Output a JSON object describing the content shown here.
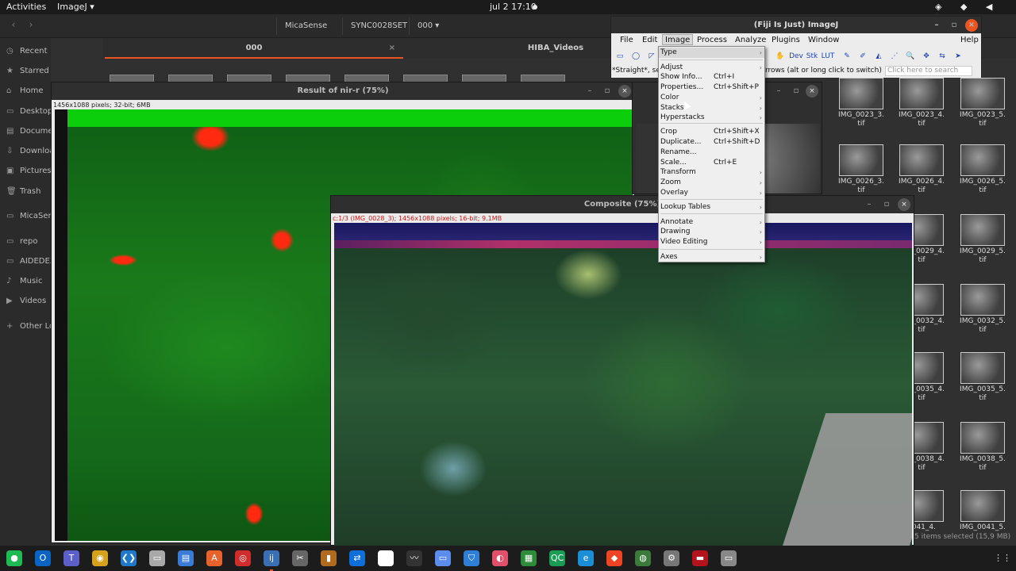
{
  "topbar": {
    "activities": "Activities",
    "app_menu": "ImageJ ▾",
    "clock": "jul 2  17:10",
    "tray": "◈ ◆ ◀ ▮▾"
  },
  "files": {
    "back": "‹",
    "forward": "›",
    "breadcrumbs": [
      "MicaSense",
      "SYNC0028SET",
      "000 ▾"
    ],
    "tabs": [
      "000",
      "HIBA_Videos"
    ],
    "tab_close": "×",
    "sidebar": [
      {
        "icon": "◷",
        "label": "Recent"
      },
      {
        "icon": "★",
        "label": "Starred"
      },
      {
        "icon": "⌂",
        "label": "Home"
      },
      {
        "icon": "▭",
        "label": "Desktop"
      },
      {
        "icon": "▤",
        "label": "Documen"
      },
      {
        "icon": "⇩",
        "label": "Downloa"
      },
      {
        "icon": "▣",
        "label": "Pictures"
      },
      {
        "icon": "🗑",
        "label": "Trash"
      },
      {
        "icon": "▭",
        "label": "MicaSen"
      },
      {
        "icon": "▭",
        "label": "repo"
      },
      {
        "icon": "▭",
        "label": "AIDEDEX"
      },
      {
        "icon": "♪",
        "label": "Music"
      },
      {
        "icon": "▶",
        "label": "Videos"
      },
      {
        "icon": "+",
        "label": "Other Lo"
      }
    ],
    "tiles": [
      "IMG_0023_3.\ntif",
      "IMG_0023_4.\ntif",
      "IMG_0023_5.\ntif",
      "IMG_0026_3.\ntif",
      "IMG_0026_4.\ntif",
      "IMG_0026_5.\ntif",
      "IMG_0029_4.\ntif",
      "IMG_0029_5.\ntif",
      "IMG_0032_4.\ntif",
      "IMG_0032_5.\ntif",
      "IMG_0035_4.\ntif",
      "IMG_0035_5.\ntif",
      "IMG_0038_4.\ntif",
      "IMG_0038_5.\ntif",
      "0041_4.",
      "IMG_0041_5."
    ],
    "status": "5 items selected (15,9 MB)"
  },
  "ratio_window": {
    "title": "Result of nir-r (75%)",
    "info": "1456x1088 pixels; 32-bit; 6MB"
  },
  "composite_window": {
    "title": "Composite (75%)",
    "info": "c:1/3 (IMG_0028_3); 1456x1088 pixels; 16-bit; 9.1MB"
  },
  "window_buttons": {
    "minimize": "–",
    "maximize": "▫",
    "close": "×"
  },
  "imagej": {
    "title": "(Fiji Is Just) ImageJ",
    "menus": [
      "File",
      "Edit",
      "Image",
      "Process",
      "Analyze",
      "Plugins",
      "Window",
      "Help"
    ],
    "tools": [
      "▭",
      "◯",
      "◸",
      "\\",
      "✋",
      "Dev",
      "Stk",
      "LUT",
      "✎",
      "✐",
      "◭",
      "⋰",
      "🔍",
      "✥",
      "⇆",
      "➤"
    ],
    "status_left": "*Straight*, se",
    "status_right": "rrows (alt or long click to switch)",
    "search_placeholder": "Click here to search"
  },
  "image_menu": {
    "items": [
      {
        "label": "Type",
        "shortcut": "",
        "arrow": "›"
      },
      {
        "label": "Adjust",
        "shortcut": "",
        "arrow": "›"
      },
      {
        "label": "Show Info...",
        "shortcut": "Ctrl+I",
        "arrow": ""
      },
      {
        "label": "Properties...",
        "shortcut": "Ctrl+Shift+P",
        "arrow": ""
      },
      {
        "label": "Color",
        "shortcut": "",
        "arrow": "›"
      },
      {
        "label": "Stacks",
        "shortcut": "",
        "arrow": "›"
      },
      {
        "label": "Hyperstacks",
        "shortcut": "",
        "arrow": "›"
      },
      {
        "label": "Crop",
        "shortcut": "Ctrl+Shift+X",
        "arrow": ""
      },
      {
        "label": "Duplicate...",
        "shortcut": "Ctrl+Shift+D",
        "arrow": ""
      },
      {
        "label": "Rename...",
        "shortcut": "",
        "arrow": ""
      },
      {
        "label": "Scale...",
        "shortcut": "Ctrl+E",
        "arrow": ""
      },
      {
        "label": "Transform",
        "shortcut": "",
        "arrow": "›"
      },
      {
        "label": "Zoom",
        "shortcut": "",
        "arrow": "›"
      },
      {
        "label": "Overlay",
        "shortcut": "",
        "arrow": "›"
      },
      {
        "label": "Lookup Tables",
        "shortcut": "",
        "arrow": "›"
      },
      {
        "label": "Annotate",
        "shortcut": "",
        "arrow": "›"
      },
      {
        "label": "Drawing",
        "shortcut": "",
        "arrow": "›"
      },
      {
        "label": "Video Editing",
        "shortcut": "",
        "arrow": "›"
      },
      {
        "label": "Axes",
        "shortcut": "",
        "arrow": "›"
      }
    ]
  },
  "taskbar": [
    {
      "name": "spotify-icon",
      "glyph": "●",
      "color": "#1db954"
    },
    {
      "name": "outlook-icon",
      "glyph": "O",
      "color": "#0a64c4"
    },
    {
      "name": "teams-icon",
      "glyph": "T",
      "color": "#5b5fc7"
    },
    {
      "name": "chrome-icon",
      "glyph": "◉",
      "color": "#d6a21b"
    },
    {
      "name": "vscode-icon",
      "glyph": "❮❯",
      "color": "#1f79c8"
    },
    {
      "name": "files-icon",
      "glyph": "▭",
      "color": "#a9a9a9"
    },
    {
      "name": "document-icon",
      "glyph": "▤",
      "color": "#3a7bd5"
    },
    {
      "name": "software-icon",
      "glyph": "A",
      "color": "#e8622c"
    },
    {
      "name": "app-red-icon",
      "glyph": "◎",
      "color": "#d12c2c"
    },
    {
      "name": "imagej-icon",
      "glyph": "ij",
      "color": "#3b6fb4"
    },
    {
      "name": "tool-icon",
      "glyph": "✂",
      "color": "#666666"
    },
    {
      "name": "app-orange-icon",
      "glyph": "▮",
      "color": "#b06b1e"
    },
    {
      "name": "teamviewer-icon",
      "glyph": "⇄",
      "color": "#0e6fd8"
    },
    {
      "name": "notes-icon",
      "glyph": "✎",
      "color": "#ffffff"
    },
    {
      "name": "monitor-icon",
      "glyph": "〰",
      "color": "#333333"
    },
    {
      "name": "window-icon",
      "glyph": "▭",
      "color": "#5a8dee"
    },
    {
      "name": "vpn-icon",
      "glyph": "⛉",
      "color": "#2f7fd6"
    },
    {
      "name": "color-picker-icon",
      "glyph": "◐",
      "color": "#e0506b"
    },
    {
      "name": "sheet-icon",
      "glyph": "▦",
      "color": "#2e8b3a"
    },
    {
      "name": "qc-icon",
      "glyph": "QC",
      "color": "#1a9c55"
    },
    {
      "name": "edge-icon",
      "glyph": "e",
      "color": "#1a8ed6"
    },
    {
      "name": "anydesk-icon",
      "glyph": "◆",
      "color": "#ef4423"
    },
    {
      "name": "globe-icon",
      "glyph": "◍",
      "color": "#3c7a3c"
    },
    {
      "name": "settings-icon",
      "glyph": "⚙",
      "color": "#777777"
    },
    {
      "name": "terminal-icon",
      "glyph": "▬",
      "color": "#b3131b"
    },
    {
      "name": "disk-icon",
      "glyph": "▭",
      "color": "#888888"
    },
    {
      "name": "app-grid-icon",
      "glyph": "⋮⋮",
      "color": "#1c1c1c"
    }
  ]
}
